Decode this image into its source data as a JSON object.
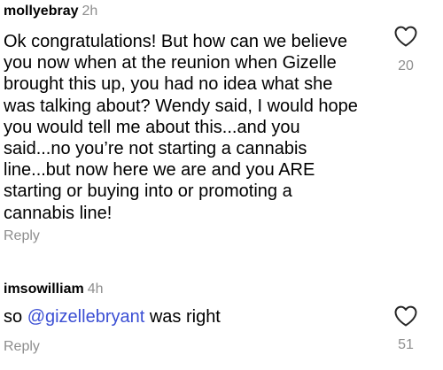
{
  "comments": [
    {
      "username": "mollyebray",
      "time": "2h",
      "text": "Ok congratulations! But how can we believe you now when at the reunion when Gizelle brought this up, you had no idea what she was talking about? Wendy said, I would hope you would tell me about this...and you said...no you’re not starting a cannabis line...but now here we are and you ARE starting or buying into or promoting a cannabis line!",
      "reply_label": "Reply",
      "likes": "20",
      "like_icon": "heart-outline-icon"
    },
    {
      "username": "imsowilliam",
      "time": "4h",
      "text_prefix": "so ",
      "mention": "@gizellebryant",
      "text_suffix": " was right",
      "reply_label": "Reply",
      "likes": "51",
      "like_icon": "heart-outline-icon"
    }
  ],
  "colors": {
    "text": "#000000",
    "muted": "#8e8e8e",
    "mention": "#3b4fd4",
    "background": "#ffffff"
  }
}
